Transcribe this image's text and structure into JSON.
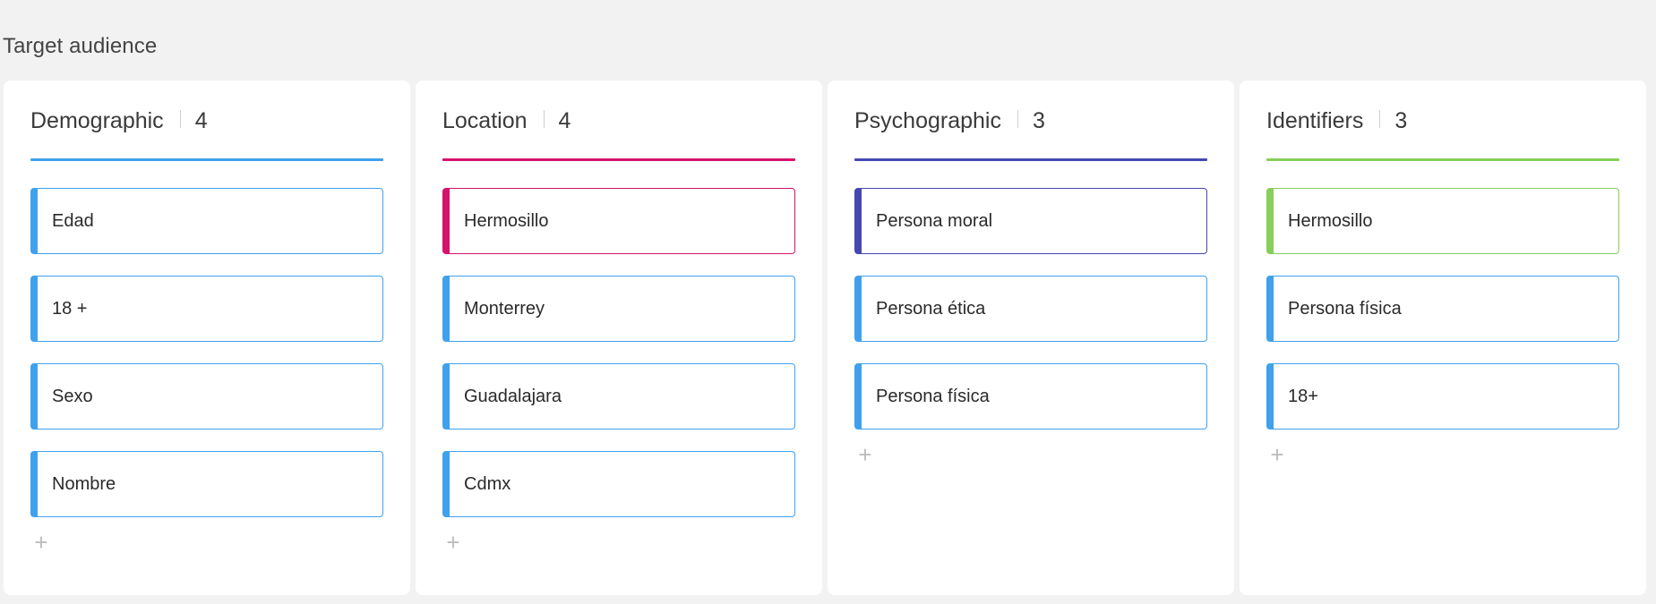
{
  "page": {
    "title": "Target audience"
  },
  "colors": {
    "default_card": "#3fa1ec",
    "blue": "#3fa1ec",
    "pink": "#d6136a",
    "indigo": "#4647b1",
    "green": "#86cf5a"
  },
  "columns": [
    {
      "title": "Demographic",
      "count": "4",
      "rule_color": "#3fa1ec",
      "cards": [
        {
          "label": "Edad",
          "color": "#3fa1ec"
        },
        {
          "label": "18 +",
          "color": "#3fa1ec"
        },
        {
          "label": "Sexo",
          "color": "#3fa1ec"
        },
        {
          "label": "Nombre",
          "color": "#3fa1ec"
        }
      ],
      "add_icon": "plus-icon",
      "add_label": "+"
    },
    {
      "title": "Location",
      "count": "4",
      "rule_color": "#d6136a",
      "cards": [
        {
          "label": "Hermosillo",
          "color": "#d6136a"
        },
        {
          "label": "Monterrey",
          "color": "#3fa1ec"
        },
        {
          "label": "Guadalajara",
          "color": "#3fa1ec"
        },
        {
          "label": "Cdmx",
          "color": "#3fa1ec"
        }
      ],
      "add_icon": "plus-icon",
      "add_label": "+"
    },
    {
      "title": "Psychographic",
      "count": "3",
      "rule_color": "#4647b1",
      "cards": [
        {
          "label": "Persona moral",
          "color": "#4647b1"
        },
        {
          "label": "Persona ética",
          "color": "#3fa1ec"
        },
        {
          "label": "Persona física",
          "color": "#3fa1ec"
        }
      ],
      "add_icon": "plus-icon",
      "add_label": "+"
    },
    {
      "title": "Identifiers",
      "count": "3",
      "rule_color": "#86cf5a",
      "cards": [
        {
          "label": "Hermosillo",
          "color": "#86cf5a"
        },
        {
          "label": "Persona física",
          "color": "#3fa1ec"
        },
        {
          "label": "18+",
          "color": "#3fa1ec"
        }
      ],
      "add_icon": "plus-icon",
      "add_label": "+"
    }
  ]
}
